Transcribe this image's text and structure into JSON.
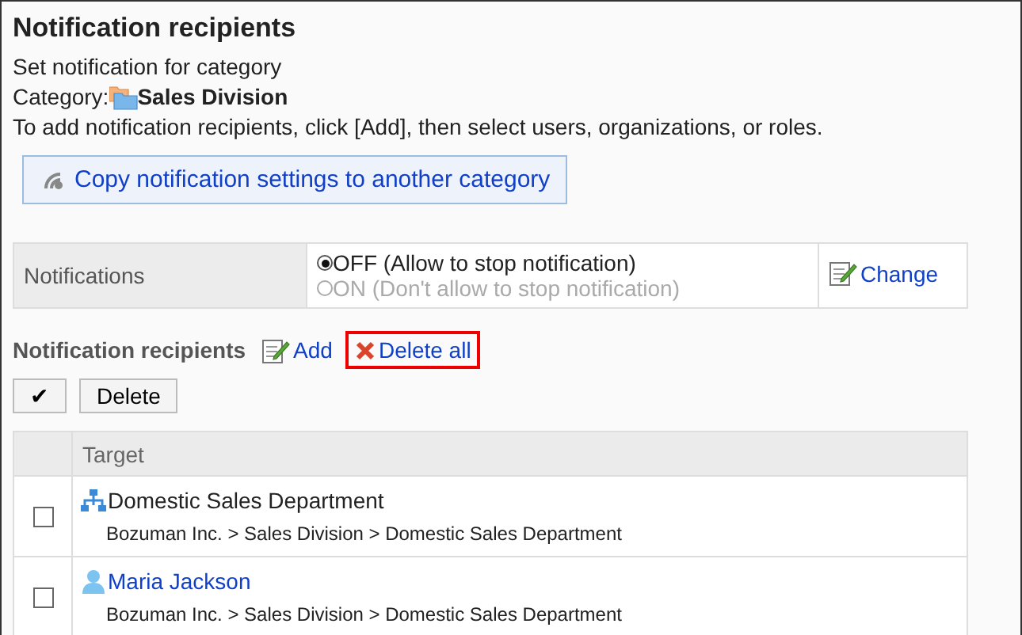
{
  "title": "Notification recipients",
  "subtitle": "Set notification for category",
  "category": {
    "label": "Category:",
    "name": "Sales Division"
  },
  "instructions": "To add notification recipients, click [Add], then select users, organizations, or roles.",
  "copy_button": "Copy notification settings to another category",
  "notifications": {
    "label": "Notifications",
    "options": [
      {
        "label": "OFF (Allow to stop notification)",
        "selected": true
      },
      {
        "label": "ON (Don't allow to stop notification)",
        "selected": false
      }
    ],
    "change_link": "Change"
  },
  "recipients": {
    "heading": "Notification recipients",
    "add_link": "Add",
    "delete_all_link": "Delete all",
    "delete_all_highlighted": true
  },
  "toolbar": {
    "select_all_button": "✔",
    "delete_button": "Delete"
  },
  "table": {
    "columns": [
      "Target"
    ],
    "rows": [
      {
        "kind": "organization",
        "name": "Domestic Sales Department",
        "path": "Bozuman Inc. > Sales Division > Domestic Sales Department",
        "checked": false
      },
      {
        "kind": "user",
        "name": "Maria Jackson",
        "path": "Bozuman Inc. > Sales Division > Domestic Sales Department",
        "checked": false
      }
    ]
  }
}
